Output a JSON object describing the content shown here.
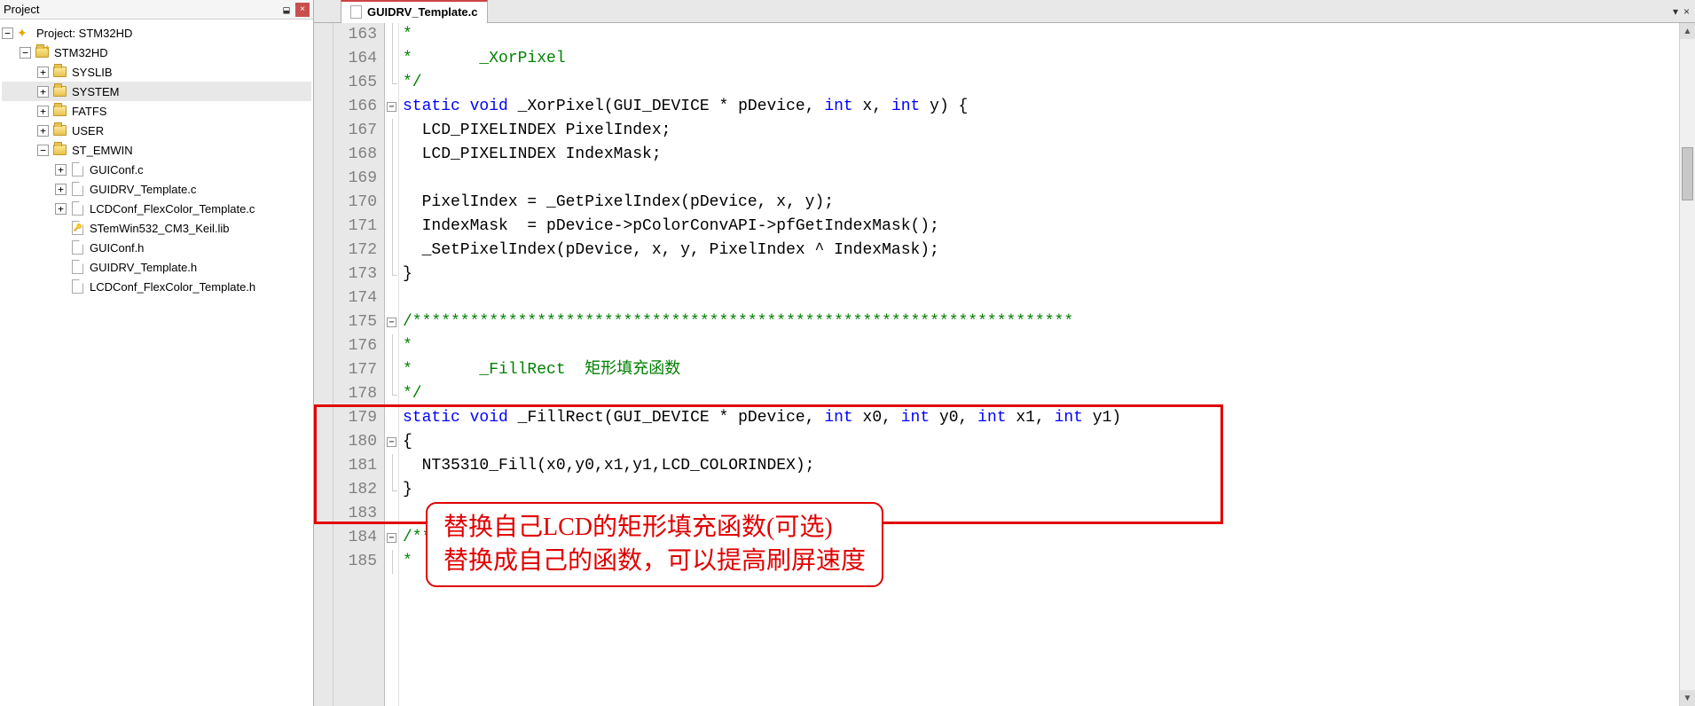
{
  "panel": {
    "title": "Project",
    "pin": "⬓",
    "close": "×"
  },
  "tree": {
    "root": "Project: STM32HD",
    "target": "STM32HD",
    "groups": [
      "SYSLIB",
      "SYSTEM",
      "FATFS",
      "USER"
    ],
    "openGroup": "ST_EMWIN",
    "files": [
      "GUIConf.c",
      "GUIDRV_Template.c",
      "LCDConf_FlexColor_Template.c",
      "STemWin532_CM3_Keil.lib",
      "GUIConf.h",
      "GUIDRV_Template.h",
      "LCDConf_FlexColor_Template.h"
    ]
  },
  "tab": {
    "file": "GUIDRV_Template.c",
    "drop": "▾",
    "close": "×"
  },
  "lines": [
    "163",
    "164",
    "165",
    "166",
    "167",
    "168",
    "169",
    "170",
    "171",
    "172",
    "173",
    "174",
    "175",
    "176",
    "177",
    "178",
    "179",
    "180",
    "181",
    "182",
    "183",
    "184",
    "185"
  ],
  "code": {
    "l163": "*",
    "l164_a": "*       _XorPixel",
    "l165": "*/",
    "l166_kw1": "static",
    "l166_kw2": "void",
    "l166_a": " _XorPixel(GUI_DEVICE * pDevice, ",
    "l166_kw3": "int",
    "l166_b": " x, ",
    "l166_kw4": "int",
    "l166_c": " y) {",
    "l167": "  LCD_PIXELINDEX PixelIndex;",
    "l168": "  LCD_PIXELINDEX IndexMask;",
    "l169": "",
    "l170": "  PixelIndex = _GetPixelIndex(pDevice, x, y);",
    "l171": "  IndexMask  = pDevice->pColorConvAPI->pfGetIndexMask();",
    "l172": "  _SetPixelIndex(pDevice, x, y, PixelIndex ^ IndexMask);",
    "l173": "}",
    "l174": "",
    "l175": "/*********************************************************************",
    "l176": "*",
    "l177": "*       _FillRect  矩形填充函数",
    "l178": "*/",
    "l179_kw1": "static",
    "l179_kw2": "void",
    "l179_a": " _FillRect(GUI_DEVICE * pDevice, ",
    "l179_kw3": "int",
    "l179_b": " x0, ",
    "l179_kw4": "int",
    "l179_c": " y0, ",
    "l179_kw5": "int",
    "l179_d": " x1, ",
    "l179_kw6": "int",
    "l179_e": " y1)",
    "l180": "{",
    "l181": "  NT35310_Fill(x0,y0,x1,y1,LCD_COLORINDEX);",
    "l182": "}",
    "l183": "",
    "l184": "/*****",
    "l185": "*"
  },
  "callout": {
    "line1": "替换自己LCD的矩形填充函数(可选)",
    "line2": "替换成自己的函数，可以提高刷屏速度"
  }
}
